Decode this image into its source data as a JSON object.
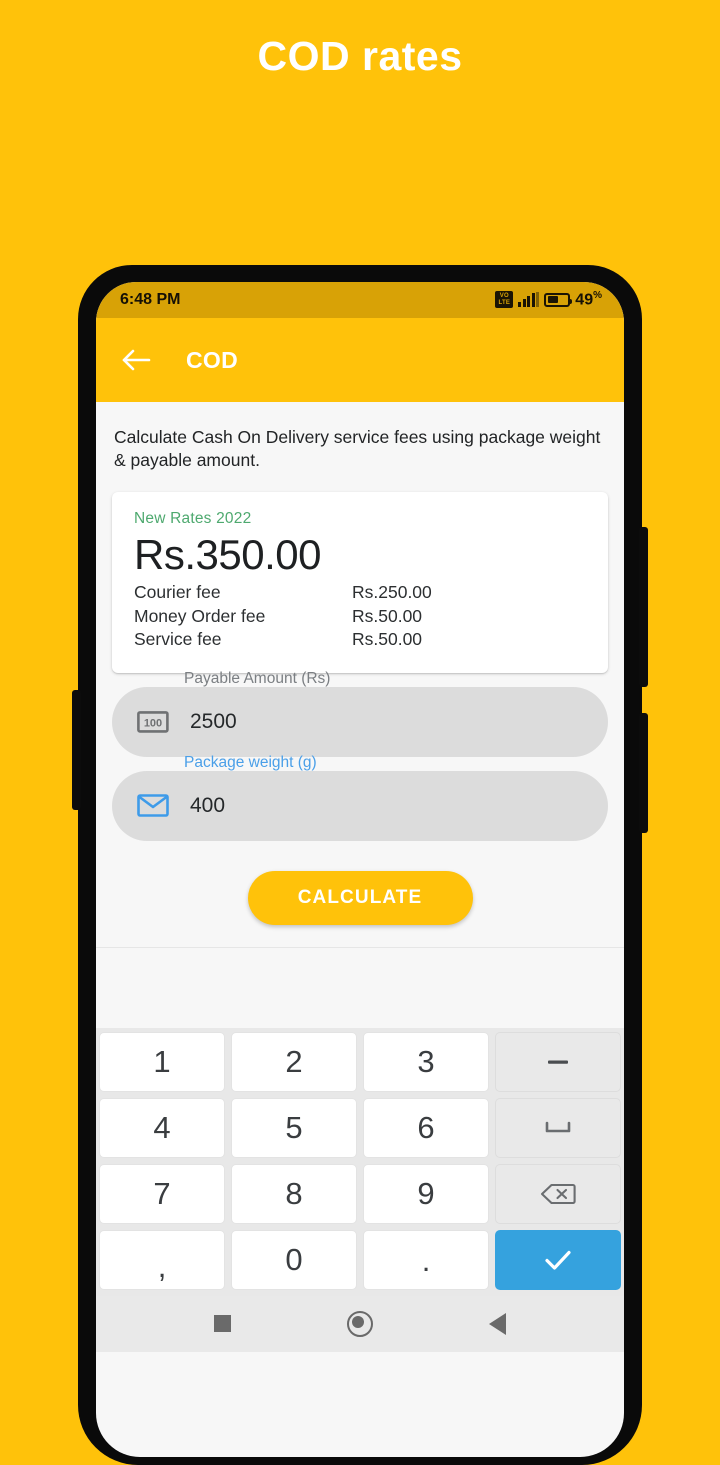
{
  "poster": {
    "title": "COD rates",
    "background_color": "#FFC20A"
  },
  "status_bar": {
    "time": "6:48 PM",
    "network_badge": "VoLTE",
    "network_badge_line1": "VO",
    "network_badge_line2": "LTE",
    "battery_percent": "49",
    "battery_percent_symbol": "%"
  },
  "app_bar": {
    "back_icon": "arrow-left-icon",
    "title": "COD",
    "background_color": "#FFC20A"
  },
  "main": {
    "intro_text": "Calculate Cash On Delivery service fees using package weight & payable amount.",
    "result_card": {
      "rates_label": "New Rates 2022",
      "rates_label_color": "#4EA96F",
      "total": "Rs.350.00",
      "fees": [
        {
          "name": "Courier fee",
          "value": "Rs.250.00"
        },
        {
          "name": "Money Order fee",
          "value": "Rs.50.00"
        },
        {
          "name": "Service fee",
          "value": "Rs.50.00"
        }
      ]
    },
    "fields": [
      {
        "label": "Payable Amount (Rs)",
        "value": "2500",
        "icon": "banknote-icon",
        "icon_text": "100",
        "focused": false,
        "label_color": "#7B7F83"
      },
      {
        "label": "Package weight (g)",
        "value": "400",
        "icon": "envelope-icon",
        "focused": true,
        "label_color": "#4A9FE8"
      }
    ],
    "calculate_button": "CALCULATE"
  },
  "keyboard": {
    "rows": [
      [
        {
          "label": "1",
          "name": "key-1",
          "type": "digit"
        },
        {
          "label": "2",
          "name": "key-2",
          "type": "digit"
        },
        {
          "label": "3",
          "name": "key-3",
          "type": "digit"
        },
        {
          "label": "−",
          "name": "key-minus",
          "type": "fn"
        }
      ],
      [
        {
          "label": "4",
          "name": "key-4",
          "type": "digit"
        },
        {
          "label": "5",
          "name": "key-5",
          "type": "digit"
        },
        {
          "label": "6",
          "name": "key-6",
          "type": "digit"
        },
        {
          "label": "␣",
          "name": "key-space",
          "type": "fn"
        }
      ],
      [
        {
          "label": "7",
          "name": "key-7",
          "type": "digit"
        },
        {
          "label": "8",
          "name": "key-8",
          "type": "digit"
        },
        {
          "label": "9",
          "name": "key-9",
          "type": "digit"
        },
        {
          "label": "⌫",
          "name": "key-backspace",
          "type": "fn"
        }
      ],
      [
        {
          "label": ",",
          "name": "key-comma",
          "type": "digit"
        },
        {
          "label": "0",
          "name": "key-0",
          "type": "digit"
        },
        {
          "label": ".",
          "name": "key-period",
          "type": "digit"
        },
        {
          "label": "✓",
          "name": "key-enter",
          "type": "enter"
        }
      ]
    ],
    "enter_color": "#35A2DE"
  },
  "nav_bar": {
    "recents_icon": "square-icon",
    "home_icon": "circle-icon",
    "back_icon": "triangle-left-icon"
  }
}
